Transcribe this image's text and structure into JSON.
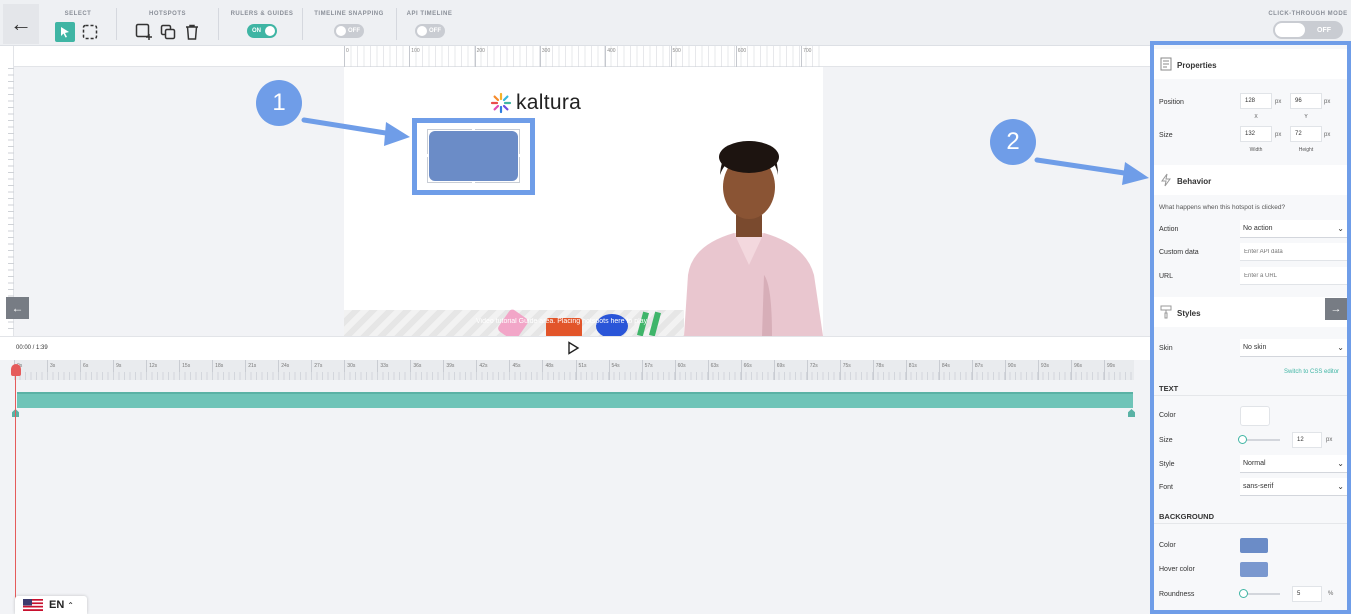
{
  "toolbar": {
    "select_label": "SELECT",
    "hotspots_label": "HOTSPOTS",
    "rulers_label": "RULERS & GUIDES",
    "rulers_toggle": "ON",
    "snapping_label": "TIMELINE SNAPPING",
    "snapping_toggle": "OFF",
    "api_label": "API TIMELINE",
    "api_toggle": "OFF",
    "clickthrough_label": "CLICK-THROUGH MODE",
    "clickthrough_toggle": "OFF"
  },
  "ruler": {
    "ticks": [
      "0",
      "100",
      "200",
      "300",
      "400",
      "500",
      "600",
      "700"
    ]
  },
  "stage": {
    "logo_text": "kaltura",
    "caption": "Video tutorial Guide area. Placing hotspots here to play"
  },
  "callouts": {
    "one": "1",
    "two": "2"
  },
  "timeline": {
    "time": "00:00 / 1:39",
    "ticks": [
      "0s",
      "3s",
      "6s",
      "9s",
      "12s",
      "15s",
      "18s",
      "21s",
      "24s",
      "27s",
      "30s",
      "33s",
      "36s",
      "39s",
      "42s",
      "45s",
      "48s",
      "51s",
      "54s",
      "57s",
      "60s",
      "63s",
      "66s",
      "69s",
      "72s",
      "75s",
      "78s",
      "81s",
      "84s",
      "87s",
      "90s",
      "93s",
      "96s",
      "99s"
    ]
  },
  "language": {
    "code": "EN"
  },
  "panel": {
    "properties_title": "Properties",
    "position_label": "Position",
    "x_value": "128",
    "y_value": "96",
    "x_sub": "X",
    "y_sub": "Y",
    "size_label": "Size",
    "width_value": "132",
    "height_value": "72",
    "width_sub": "Width",
    "height_sub": "Height",
    "unit_px": "px",
    "behavior_title": "Behavior",
    "behavior_question": "What happens when this hotspot is clicked?",
    "action_label": "Action",
    "action_value": "No action",
    "custom_data_label": "Custom data",
    "custom_data_placeholder": "Enter API data",
    "url_label": "URL",
    "url_placeholder": "Enter a URL",
    "styles_title": "Styles",
    "skin_label": "Skin",
    "skin_value": "No skin",
    "css_link": "Switch to CSS editor",
    "text_head": "TEXT",
    "color_label": "Color",
    "text_size_label": "Size",
    "text_size_value": "12",
    "style_label": "Style",
    "style_value": "Normal",
    "font_label": "Font",
    "font_value": "sans-serif",
    "background_head": "BACKGROUND",
    "bg_color_label": "Color",
    "hover_color_label": "Hover color",
    "roundness_label": "Roundness",
    "roundness_value": "5",
    "unit_pct": "%"
  },
  "colors": {
    "accent": "#3fb5a4",
    "hotspot": "#6b8cc7",
    "callout": "#6f9de8",
    "playhead": "#e55b5b"
  }
}
